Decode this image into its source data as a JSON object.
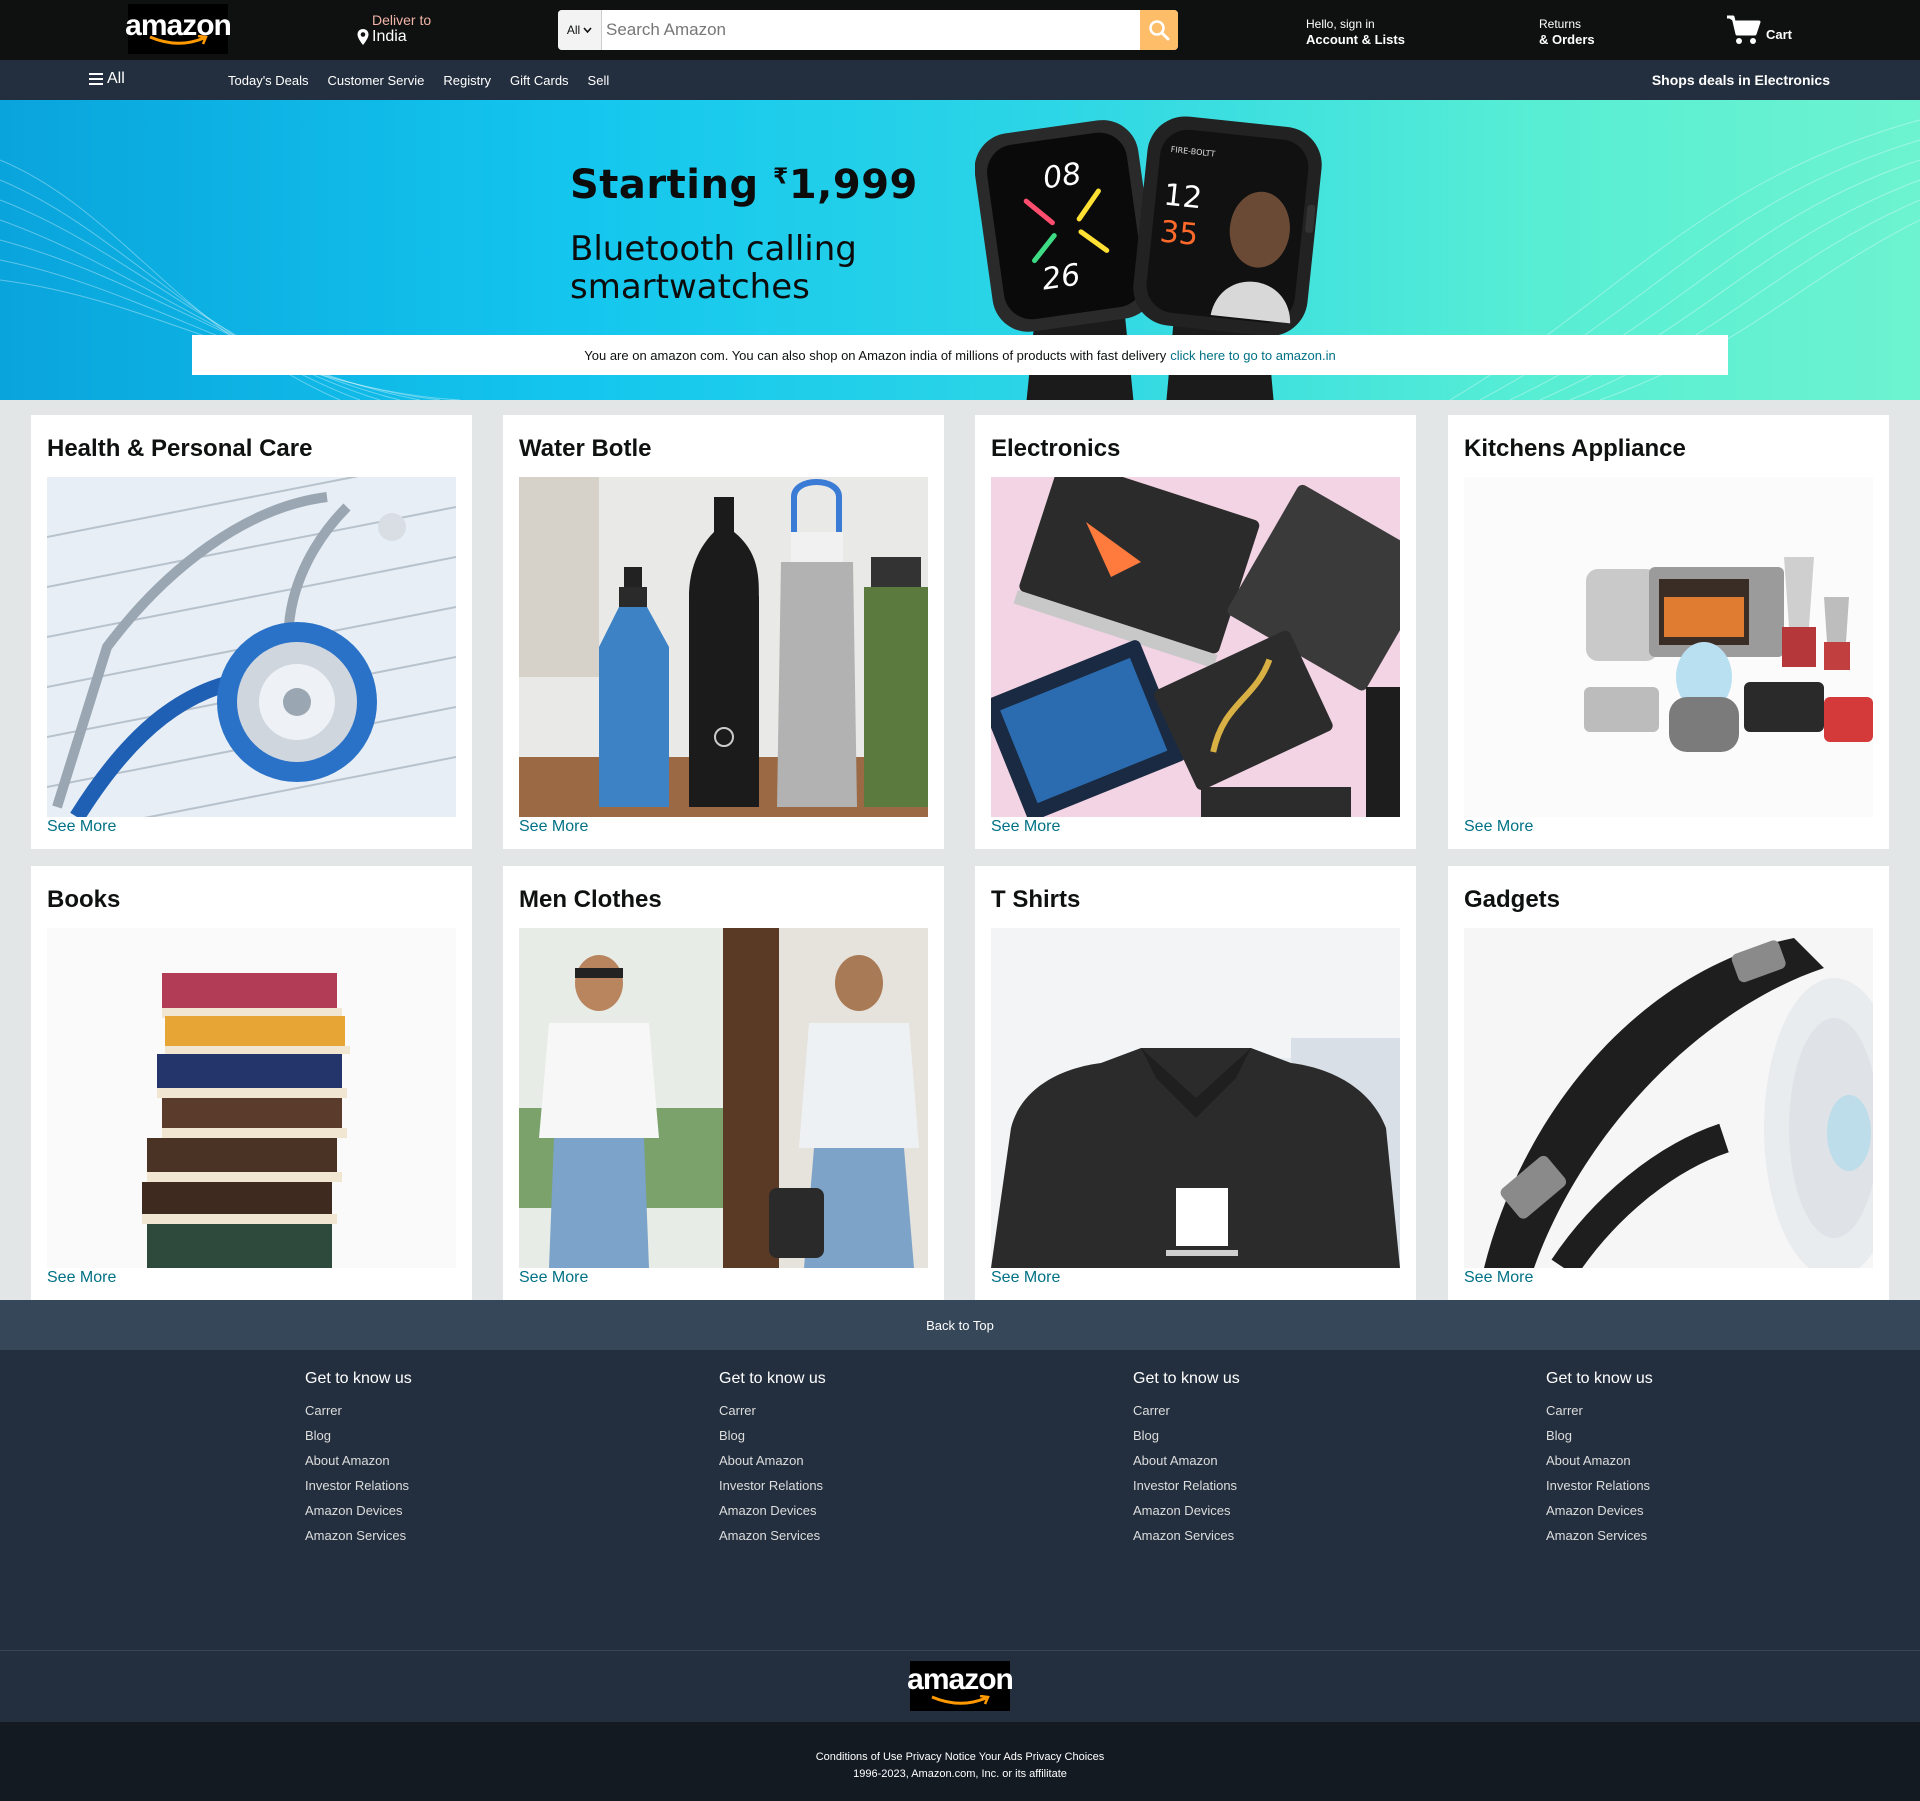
{
  "header": {
    "logo_text": "amazon",
    "deliver_label": "Deliver to",
    "deliver_country": "India",
    "search_category": "All",
    "search_placeholder": "Search Amazon",
    "account_greeting": "Hello, sign in",
    "account_label": "Account & Lists",
    "returns_label": "Returns",
    "orders_label": "& Orders",
    "cart_label": "Cart"
  },
  "nav": {
    "all_label": "All",
    "links": [
      "Today's Deals",
      "Customer Servie",
      "Registry",
      "Gift Cards",
      "Sell"
    ],
    "promo": "Shops deals in Electronics"
  },
  "banner": {
    "title_prefix": "Starting ",
    "currency": "₹",
    "price": "1,999",
    "subtitle": "Bluetooth calling smartwatches",
    "watch1_time_top": "08",
    "watch1_time_bottom": "26",
    "watch2_brand": "FIRE-BOLTT",
    "watch2_time_top": "12",
    "watch2_time_bottom": "35"
  },
  "notice": {
    "text": "You are on amazon com. You can also shop on Amazon india of millions of products with fast delivery",
    "link": "click here to go to amazon.in"
  },
  "cards": [
    {
      "title": "Health & Personal Care",
      "link": "See More"
    },
    {
      "title": "Water Botle",
      "link": "See More"
    },
    {
      "title": "Electronics",
      "link": "See More"
    },
    {
      "title": "Kitchens Appliance",
      "link": "See More"
    },
    {
      "title": "Books",
      "link": "See More"
    },
    {
      "title": "Men Clothes",
      "link": "See More"
    },
    {
      "title": "T Shirts",
      "link": "See More"
    },
    {
      "title": "Gadgets",
      "link": "See More"
    }
  ],
  "footer": {
    "back_to_top": "Back to Top",
    "columns": [
      {
        "heading": "Get to know us",
        "links": [
          "Carrer",
          "Blog",
          "About Amazon",
          "Investor Relations",
          "Amazon Devices",
          "Amazon Services"
        ]
      },
      {
        "heading": "Get to know us",
        "links": [
          "Carrer",
          "Blog",
          "About Amazon",
          "Investor Relations",
          "Amazon Devices",
          "Amazon Services"
        ]
      },
      {
        "heading": "Get to know us",
        "links": [
          "Carrer",
          "Blog",
          "About Amazon",
          "Investor Relations",
          "Amazon Devices",
          "Amazon Services"
        ]
      },
      {
        "heading": "Get to know us",
        "links": [
          "Carrer",
          "Blog",
          "About Amazon",
          "Investor Relations",
          "Amazon Devices",
          "Amazon Services"
        ]
      }
    ],
    "logo_text": "amazon",
    "legal": "Conditions of Use Privacy Notice Your Ads Privacy Choices",
    "copyright": "1996-2023, Amazon.com, Inc. or its affilitate"
  },
  "colors": {
    "header_bg": "#0f1111",
    "nav_bg": "#232f3e",
    "search_button": "#febd69",
    "link": "#007185",
    "page_bg": "#e3e6e6"
  }
}
